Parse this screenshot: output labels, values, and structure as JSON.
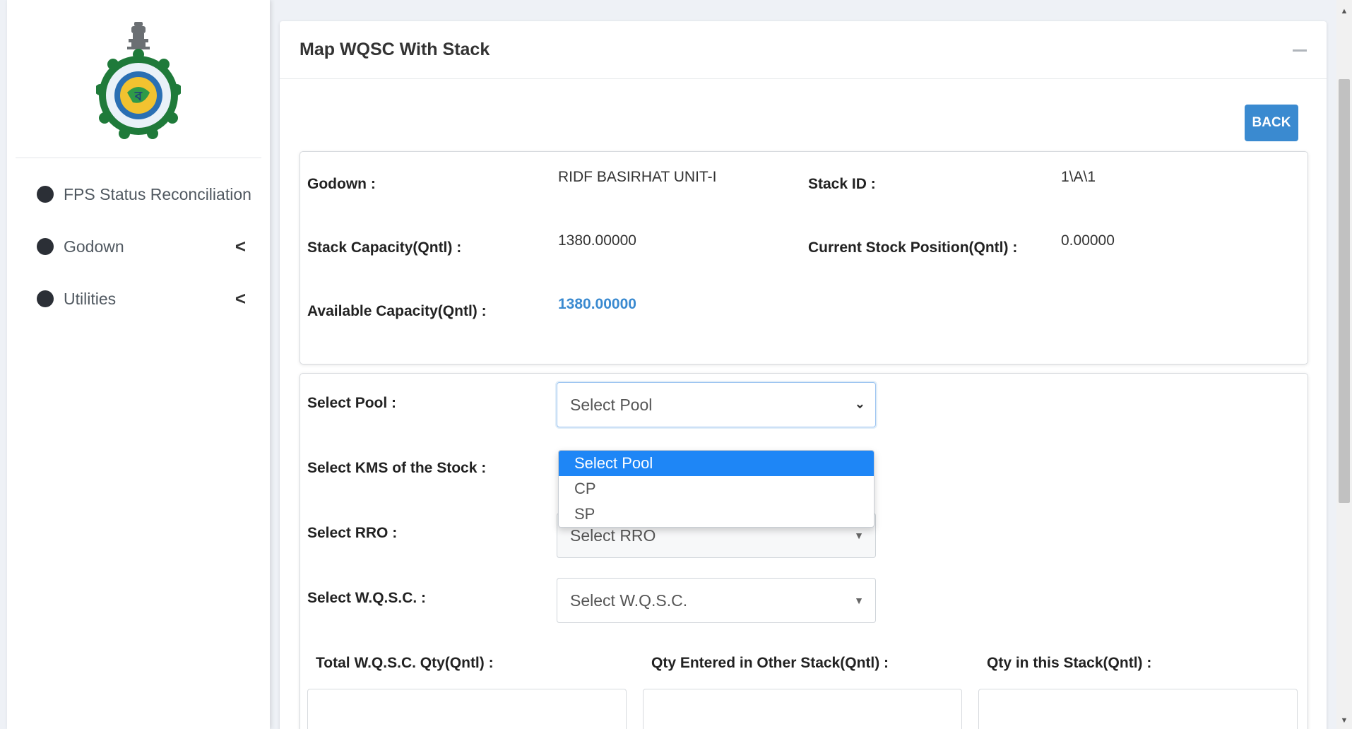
{
  "sidebar": {
    "logo_icon": "west-bengal-emblem-icon",
    "items": [
      {
        "label": "FPS Status Reconciliation",
        "has_chevron": false
      },
      {
        "label": "Godown",
        "has_chevron": true
      },
      {
        "label": "Utilities",
        "has_chevron": true
      }
    ],
    "chevron_glyph": "<"
  },
  "card": {
    "title": "Map WQSC With Stack",
    "back_label": "BACK"
  },
  "info": {
    "godown_label": "Godown :",
    "godown_value": "RIDF BASIRHAT UNIT-I",
    "stack_id_label": "Stack ID :",
    "stack_id_value": "1\\A\\1",
    "stack_capacity_label": "Stack Capacity(Qntl) :",
    "stack_capacity_value": "1380.00000",
    "current_stock_label": "Current Stock Position(Qntl) :",
    "current_stock_value": "0.00000",
    "available_capacity_label": "Available Capacity(Qntl) :",
    "available_capacity_value": "1380.00000"
  },
  "form": {
    "pool_label": "Select Pool :",
    "pool_selected": "Select Pool",
    "pool_options": [
      "Select Pool",
      "CP",
      "SP"
    ],
    "kms_label": "Select KMS of the Stock :",
    "rro_label": "Select RRO :",
    "rro_selected": "Select RRO",
    "wqsc_label": "Select W.Q.S.C. :",
    "wqsc_selected": "Select W.Q.S.C.",
    "total_qty_label": "Total W.Q.S.C. Qty(Qntl) :",
    "other_stack_label": "Qty Entered in Other Stack(Qntl) :",
    "this_stack_label": "Qty in this Stack(Qntl) :"
  },
  "colors": {
    "accent": "#3a8ad0",
    "dropdown_highlight": "#1e86f6"
  }
}
